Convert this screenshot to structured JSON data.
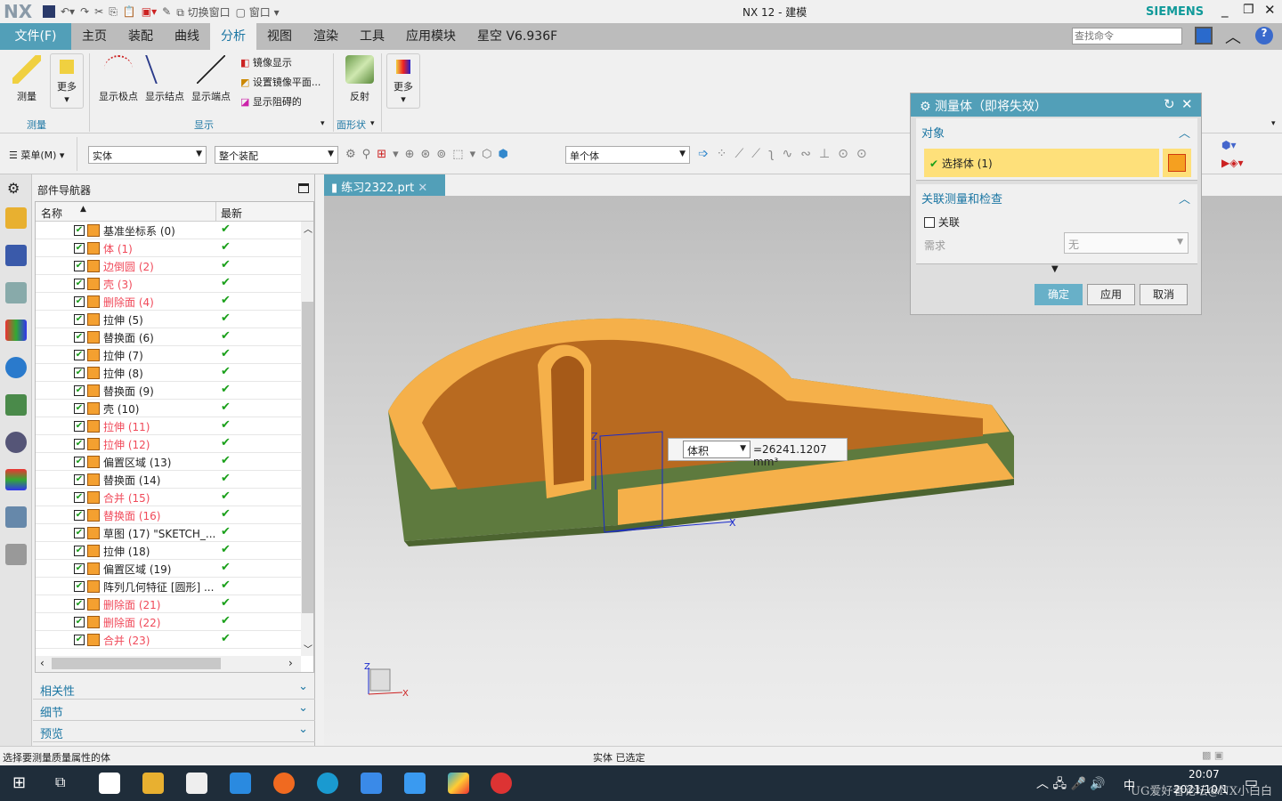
{
  "titlebar": {
    "logo": "NX",
    "switch_window": "切换窗口",
    "window": "窗口",
    "title": "NX 12 - 建模",
    "brand": "SIEMENS"
  },
  "menu": {
    "file": "文件(F)",
    "tabs": [
      "主页",
      "装配",
      "曲线",
      "分析",
      "视图",
      "渲染",
      "工具",
      "应用模块",
      "星空 V6.936F"
    ],
    "active": "分析",
    "search_placeholder": "查找命令"
  },
  "ribbon": {
    "measure": "测量",
    "more": "更多",
    "show_poles": "显示极点",
    "show_knots": "显示结点",
    "show_ends": "显示端点",
    "mirror_display": "镜像显示",
    "set_mirror_plane": "设置镜像平面...",
    "show_blocking": "显示阻碍的",
    "reflection": "反射",
    "more2": "更多",
    "group_measure": "测量",
    "group_display": "显示",
    "group_face_shape": "面形状"
  },
  "toolbar2": {
    "menu": "菜单(M)",
    "filter": "实体",
    "scope": "整个装配",
    "body_rule": "单个体"
  },
  "navigator": {
    "title": "部件导航器",
    "col_name": "名称",
    "col_latest": "最新",
    "items": [
      {
        "label": "基准坐标系 (0)",
        "suppressed": false
      },
      {
        "label": "体 (1)",
        "suppressed": true
      },
      {
        "label": "边倒圆 (2)",
        "suppressed": true
      },
      {
        "label": "壳 (3)",
        "suppressed": true
      },
      {
        "label": "删除面 (4)",
        "suppressed": true
      },
      {
        "label": "拉伸 (5)",
        "suppressed": false
      },
      {
        "label": "替换面 (6)",
        "suppressed": false
      },
      {
        "label": "拉伸 (7)",
        "suppressed": false
      },
      {
        "label": "拉伸 (8)",
        "suppressed": false
      },
      {
        "label": "替换面 (9)",
        "suppressed": false
      },
      {
        "label": "壳 (10)",
        "suppressed": false
      },
      {
        "label": "拉伸 (11)",
        "suppressed": true
      },
      {
        "label": "拉伸 (12)",
        "suppressed": true
      },
      {
        "label": "偏置区域 (13)",
        "suppressed": false
      },
      {
        "label": "替换面 (14)",
        "suppressed": false
      },
      {
        "label": "合并 (15)",
        "suppressed": true
      },
      {
        "label": "替换面 (16)",
        "suppressed": true
      },
      {
        "label": "草图 (17) \"SKETCH_...",
        "suppressed": false
      },
      {
        "label": "拉伸 (18)",
        "suppressed": false
      },
      {
        "label": "偏置区域 (19)",
        "suppressed": false
      },
      {
        "label": "阵列几何特征 [圆形] ...",
        "suppressed": false
      },
      {
        "label": "删除面 (21)",
        "suppressed": true
      },
      {
        "label": "删除面 (22)",
        "suppressed": true
      },
      {
        "label": "合并 (23)",
        "suppressed": true
      }
    ],
    "panels": [
      "相关性",
      "细节",
      "预览"
    ]
  },
  "file_tab": "练习2322.prt",
  "measure_tag": {
    "type": "体积",
    "value": "=26241.1207 mm³"
  },
  "dialog": {
    "title": "测量体（即将失效）",
    "section_object": "对象",
    "select_body": "选择体 (1)",
    "section_assoc": "关联测量和检查",
    "assoc_checkbox": "关联",
    "requirement_label": "需求",
    "requirement_value": "无",
    "ok": "确定",
    "apply": "应用",
    "cancel": "取消"
  },
  "status": {
    "prompt": "选择要测量质量属性的体",
    "selection": "实体 已选定"
  },
  "taskbar": {
    "time": "20:07",
    "date": "2021/10/1",
    "ime": "中",
    "watermark": "UG爱好者论坛@NX小白白"
  },
  "colors": {
    "accent": "#529fb8",
    "model_orange": "#f5b04a",
    "model_green": "#5e7a3e",
    "ok_green": "#1aa01a",
    "suppressed_red": "#f04a5a"
  }
}
